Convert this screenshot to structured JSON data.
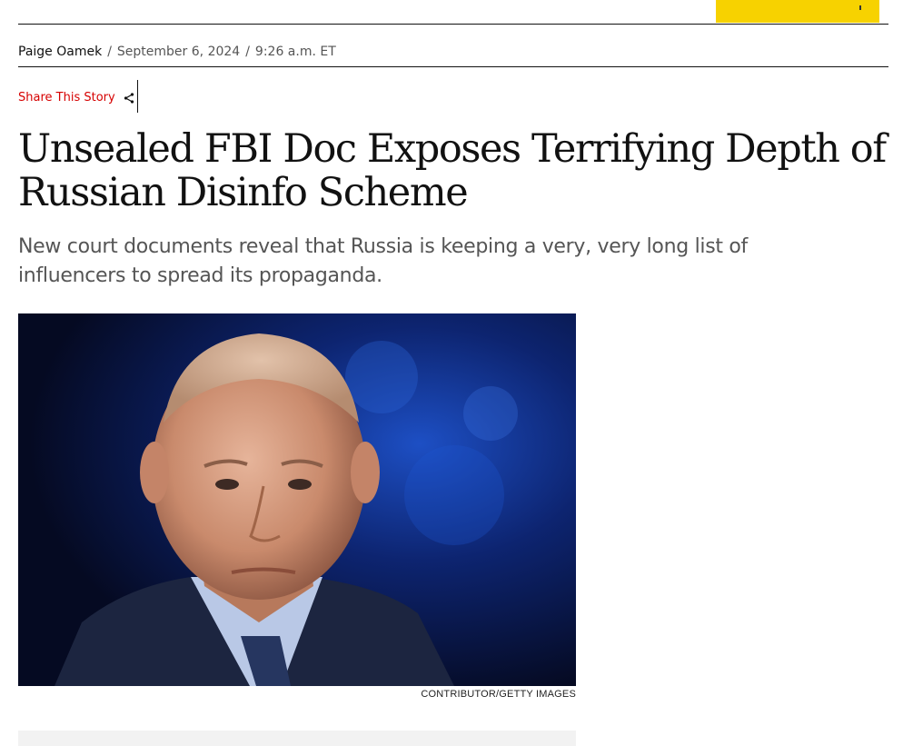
{
  "byline": {
    "author": "Paige Oamek",
    "separator": "/",
    "date": "September 6, 2024",
    "time": "9:26 a.m. ET"
  },
  "share": {
    "label": "Share This Story",
    "icon": "share-icon",
    "color": "#d60000"
  },
  "article": {
    "headline": "Unsealed FBI Doc Exposes Terrifying Depth of Russian Disinfo Scheme",
    "dek": "New court documents reveal that Russia is keeping a very, very long list of influencers to spread its propaganda.",
    "image_credit": "CONTRIBUTOR/GETTY IMAGES"
  },
  "colors": {
    "accent_yellow": "#f7d200",
    "text": "#111111",
    "muted": "#555555"
  }
}
